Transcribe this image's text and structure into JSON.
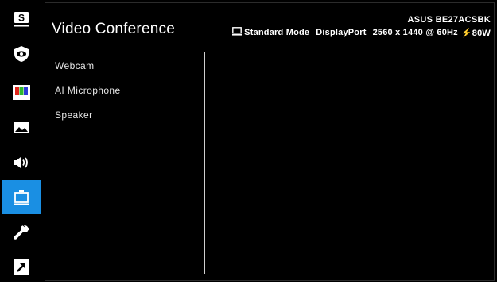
{
  "page": {
    "title": "Video Conference",
    "model": "ASUS BE27ACSBK"
  },
  "status": {
    "mode": "Standard Mode",
    "input": "DisplayPort",
    "resolution": "2560 x 1440 @ 60Hz",
    "power": "⚡80W"
  },
  "menu": {
    "items": [
      {
        "label": "Webcam"
      },
      {
        "label": "AI Microphone"
      },
      {
        "label": "Speaker"
      }
    ]
  },
  "rail": {
    "items": [
      {
        "icon": "splendid-icon",
        "active": false
      },
      {
        "icon": "eye-care-icon",
        "active": false
      },
      {
        "icon": "color-icon",
        "active": false
      },
      {
        "icon": "image-icon",
        "active": false
      },
      {
        "icon": "sound-icon",
        "active": false
      },
      {
        "icon": "video-conference-icon",
        "active": true
      },
      {
        "icon": "system-setup-icon",
        "active": false
      },
      {
        "icon": "shortcut-icon",
        "active": false
      }
    ]
  },
  "colors": {
    "background": "#000000",
    "accent": "#1a8fe3",
    "text": "#ffffff"
  }
}
